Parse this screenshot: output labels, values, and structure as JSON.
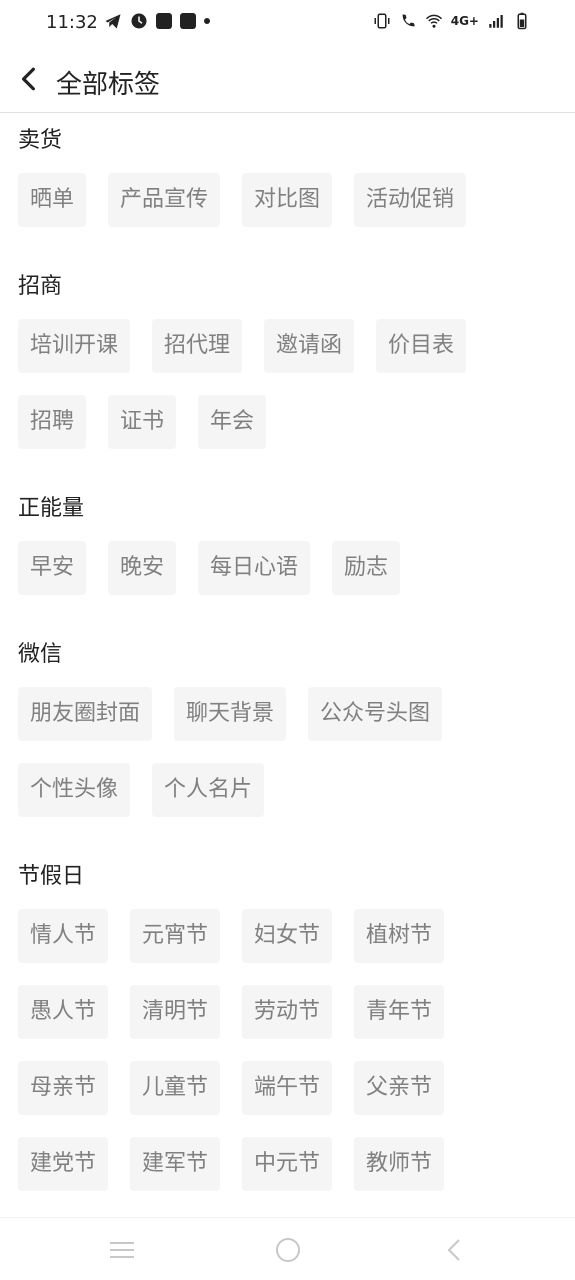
{
  "status": {
    "time": "11:32",
    "network": "4G+",
    "left_icons": [
      "telegram-icon",
      "clock-icon",
      "bag-icon",
      "bag-icon",
      "dot-icon"
    ],
    "right_icons": [
      "vibrate-icon",
      "wifi-call-icon",
      "wifi-icon",
      "signal-icon",
      "battery-icon"
    ]
  },
  "header": {
    "title": "全部标签"
  },
  "groups": [
    {
      "title": "卖货",
      "tags": [
        "晒单",
        "产品宣传",
        "对比图",
        "活动促销"
      ]
    },
    {
      "title": "招商",
      "tags": [
        "培训开课",
        "招代理",
        "邀请函",
        "价目表",
        "招聘",
        "证书",
        "年会"
      ]
    },
    {
      "title": "正能量",
      "tags": [
        "早安",
        "晚安",
        "每日心语",
        "励志"
      ]
    },
    {
      "title": "微信",
      "tags": [
        "朋友圈封面",
        "聊天背景",
        "公众号头图",
        "个性头像",
        "个人名片"
      ]
    },
    {
      "title": "节假日",
      "tags": [
        "情人节",
        "元宵节",
        "妇女节",
        "植树节",
        "愚人节",
        "清明节",
        "劳动节",
        "青年节",
        "母亲节",
        "儿童节",
        "端午节",
        "父亲节",
        "建党节",
        "建军节",
        "中元节",
        "教师节"
      ]
    }
  ],
  "nav": {
    "icons": [
      "menu-icon",
      "home-circle-icon",
      "back-arrow-icon"
    ]
  }
}
